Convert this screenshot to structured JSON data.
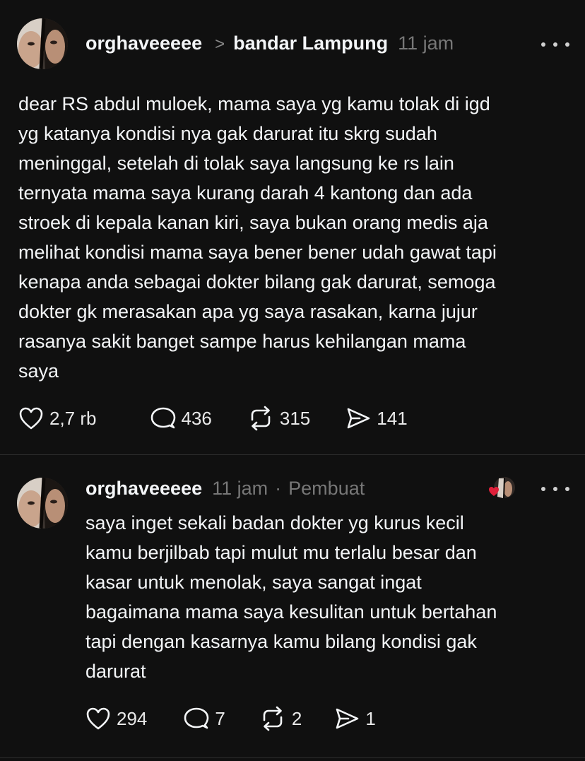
{
  "post": {
    "username": "orghaveeeee",
    "chevron": ">",
    "topic": "bandar Lampung",
    "time": "11 jam",
    "text": "dear RS abdul muloek, mama saya yg kamu tolak di igd\nyg katanya kondisi nya gak darurat itu skrg sudah\nmeninggal, setelah di tolak saya langsung ke rs lain\nternyata mama saya kurang darah 4 kantong dan ada\nstroek di kepala kanan kiri, saya bukan orang medis aja\nmelihat kondisi mama saya bener bener udah gawat tapi\nkenapa anda sebagai dokter bilang gak darurat, semoga\ndokter gk merasakan apa yg saya rasakan, karna jujur\nrasanya sakit banget sampe harus kehilangan mama\nsaya",
    "likes": "2,7 rb",
    "comments": "436",
    "reposts": "315",
    "shares": "141",
    "icons": {
      "avatar": "avatar-photo",
      "more": "more-dots-icon",
      "like": "heart-icon",
      "comment": "comment-bubble-icon",
      "repost": "repost-icon",
      "share": "send-icon"
    }
  },
  "reply": {
    "username": "orghaveeeee",
    "time": "11 jam",
    "separator": "·",
    "creator_label": "Pembuat",
    "text": "saya inget sekali badan dokter yg kurus kecil\nkamu berjilbab tapi mulut mu terlalu besar dan\nkasar untuk menolak, saya sangat ingat\nbagaimana mama saya kesulitan untuk bertahan\ntapi dengan kasarnya kamu bilang kondisi gak\ndarurat",
    "likes": "294",
    "comments": "7",
    "reposts": "2",
    "shares": "1",
    "icons": {
      "avatar": "avatar-photo",
      "liked_by_creator": "liked-by-creator-avatar",
      "more": "more-dots-icon",
      "like": "heart-icon",
      "comment": "comment-bubble-icon",
      "repost": "repost-icon",
      "share": "send-icon"
    }
  },
  "colors": {
    "background": "#101010",
    "text": "#f3f5f7",
    "secondary": "#777777",
    "heart_red": "#e0203a"
  }
}
